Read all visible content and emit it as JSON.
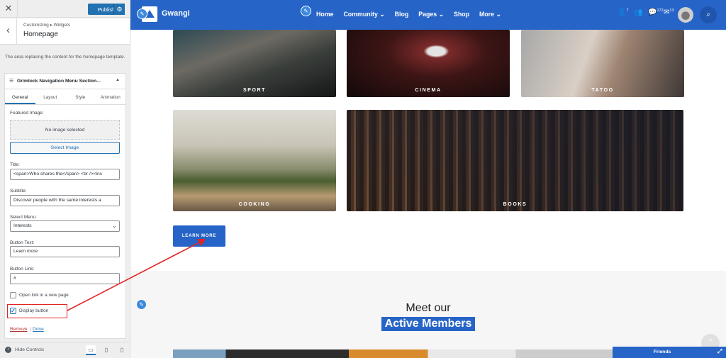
{
  "customizer": {
    "publish_label": "Publish",
    "breadcrumb": "Customizing ▸ Widgets",
    "page_title": "Homepage",
    "description": "The area replacing the content for the homepage template.",
    "widget_title": "Grimlock Navigation Menu Section...",
    "tabs": [
      "General",
      "Layout",
      "Style",
      "Animation"
    ],
    "fields": {
      "featured_image_label": "Featured Image:",
      "no_image_text": "No image selected",
      "select_image_label": "Select Image",
      "title_label": "Title:",
      "title_value": "<span>Who shares the</span> <br /><ins",
      "subtitle_label": "Subtitle:",
      "subtitle_value": "Discover people with the same interests a",
      "menu_label": "Select Menu:",
      "menu_value": "Interests",
      "button_text_label": "Button Text:",
      "button_text_value": "Learn more",
      "button_link_label": "Button Link:",
      "button_link_value": "#",
      "open_new_page_label": "Open link in a new page",
      "display_button_label": "Display button"
    },
    "remove_label": "Remove",
    "separator": "|",
    "done_label": "Done",
    "hide_controls_label": "Hide Controls"
  },
  "site": {
    "brand": "Gwangi",
    "menu": [
      "Home",
      "Community",
      "Blog",
      "Pages",
      "Shop",
      "More"
    ],
    "dropdown_items": [
      "Community",
      "Pages",
      "More"
    ],
    "badges": {
      "requests": "7",
      "groups": "",
      "messages": "172",
      "mail": "13"
    },
    "tiles": [
      "SPORT",
      "CINEMA",
      "TATOO",
      "COOKING",
      "BOOKS"
    ],
    "learn_more_label": "LEARN MORE",
    "meet_heading": "Meet our",
    "active_members_heading": "Active Members",
    "friends_label": "Friends"
  },
  "icons": {
    "close": "close-icon",
    "settings": "gear-icon",
    "back": "chevron-left-icon",
    "edit": "pencil-icon",
    "search": "search-icon",
    "scroll_top": "chevron-up-icon",
    "expand": "expand-icon"
  },
  "colors": {
    "wp_blue": "#2271b1",
    "site_blue": "#2764c7",
    "highlight_red": "#e02424"
  }
}
